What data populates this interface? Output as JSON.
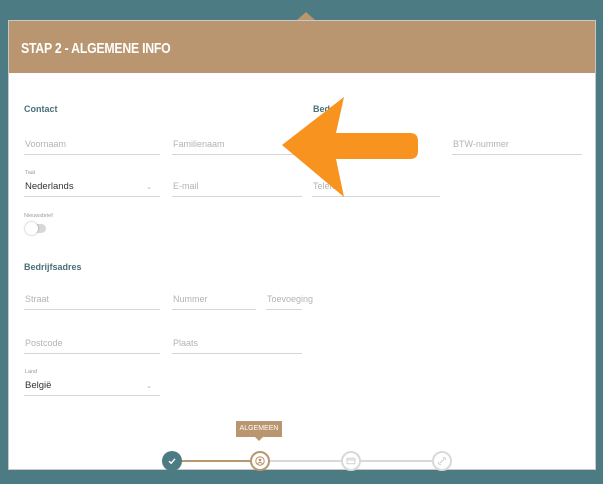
{
  "header": {
    "title": "STAP 2 - ALGEMENE INFO"
  },
  "sections": {
    "contact": "Contact",
    "bedrijf": "Bedri",
    "bedrijfsadres": "Bedrijfsadres"
  },
  "fields": {
    "voornaam": {
      "placeholder": "Voornaam"
    },
    "familienaam": {
      "placeholder": "Familienaam"
    },
    "btw": {
      "placeholder": "BTW-nummer"
    },
    "taal": {
      "label": "Taal",
      "value": "Nederlands"
    },
    "email": {
      "placeholder": "E-mail"
    },
    "telefoon": {
      "placeholder": "Telefo"
    },
    "nieuwsbrief": {
      "label": "Nieuwsbrief",
      "on": false
    },
    "straat": {
      "placeholder": "Straat"
    },
    "nummer": {
      "placeholder": "Nummer"
    },
    "toevoeging": {
      "placeholder": "Toevoeging"
    },
    "postcode": {
      "placeholder": "Postcode"
    },
    "plaats": {
      "placeholder": "Plaats"
    },
    "land": {
      "label": "Land",
      "value": "België"
    }
  },
  "stepper": {
    "active_label": "ALGEMEEN",
    "steps": [
      {
        "name": "completed",
        "icon": "check-icon",
        "state": "done"
      },
      {
        "name": "algemeen",
        "icon": "user-icon",
        "state": "active"
      },
      {
        "name": "payment",
        "icon": "card-icon",
        "state": "todo"
      },
      {
        "name": "confirm",
        "icon": "link-icon",
        "state": "todo"
      }
    ]
  },
  "colors": {
    "brand": "#b9966f",
    "teal": "#4b6f78",
    "step_done": "#4d7b83",
    "arrow": "#f7931e"
  }
}
